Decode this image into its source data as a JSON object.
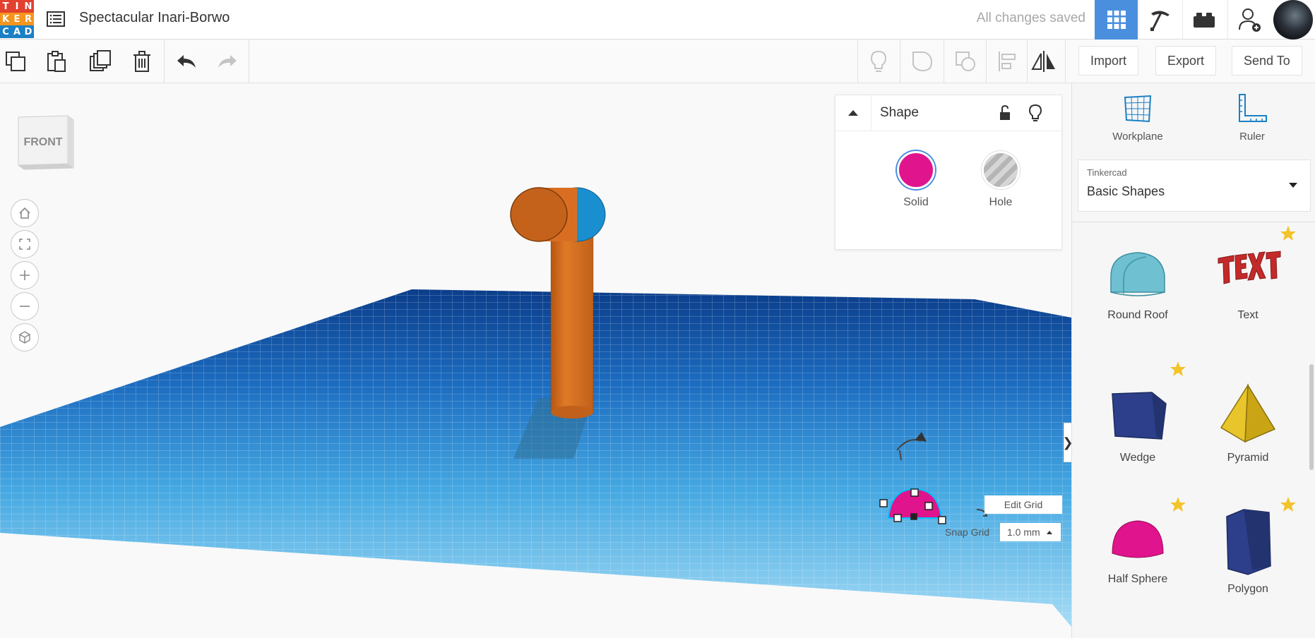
{
  "app": {
    "logo_letters": [
      "T",
      "I",
      "N",
      "K",
      "E",
      "R",
      "C",
      "A",
      "D"
    ],
    "logo_colors": [
      "#e2412f",
      "#e2412f",
      "#e2412f",
      "#f5951e",
      "#f5951e",
      "#f5951e",
      "#1b80c5",
      "#1b80c5",
      "#1b80c5"
    ]
  },
  "header": {
    "design_title": "Spectacular Inari-Borwo",
    "save_status": "All changes saved",
    "tabs": [
      {
        "name": "3d-design-view",
        "icon": "grid-icon",
        "active": true
      },
      {
        "name": "codeblocks-view",
        "icon": "pickaxe-icon",
        "active": false
      },
      {
        "name": "bricks-view",
        "icon": "brick-icon",
        "active": false
      }
    ],
    "invite_icon": "user-add-icon"
  },
  "toolbar": {
    "left_tools": [
      "copy-icon",
      "paste-icon",
      "duplicate-icon",
      "delete-icon",
      "undo-icon",
      "redo-icon"
    ],
    "right_tools": [
      "light-icon",
      "group-icon",
      "ungroup-icon",
      "align-icon",
      "mirror-icon"
    ],
    "import_label": "Import",
    "export_label": "Export",
    "send_to_label": "Send To"
  },
  "viewport": {
    "viewcube_label": "FRONT",
    "nav_buttons": [
      "home-icon",
      "fit-icon",
      "zoom-in-icon",
      "zoom-out-icon",
      "ortho-icon"
    ],
    "edit_grid_label": "Edit Grid",
    "snap_grid_label": "Snap Grid",
    "snap_grid_value": "1.0 mm"
  },
  "inspector": {
    "title": "Shape",
    "solid_label": "Solid",
    "hole_label": "Hole",
    "solid_color": "#e0148c"
  },
  "library": {
    "workplane_label": "Workplane",
    "ruler_label": "Ruler",
    "category_sub": "Tinkercad",
    "category_main": "Basic Shapes",
    "shapes": [
      {
        "label": "Round Roof",
        "starred": false
      },
      {
        "label": "Text",
        "starred": true
      },
      {
        "label": "Wedge",
        "starred": true
      },
      {
        "label": "Pyramid",
        "starred": false
      },
      {
        "label": "Half Sphere",
        "starred": true
      },
      {
        "label": "Polygon",
        "starred": true
      }
    ]
  },
  "colors": {
    "accent": "#4a8fde",
    "workplane_blue": "#3aa6df",
    "object_orange": "#d4691c",
    "object_blue": "#1a8fcf",
    "selected_magenta": "#e0148c"
  }
}
